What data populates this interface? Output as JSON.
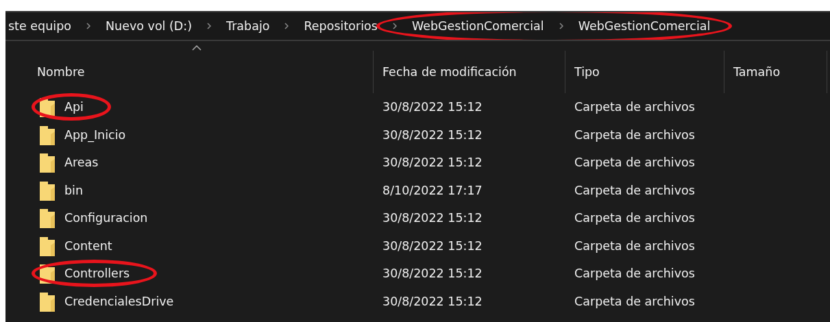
{
  "breadcrumb": [
    {
      "label": "ste equipo",
      "highlighted": false
    },
    {
      "label": "Nuevo vol (D:)",
      "highlighted": false
    },
    {
      "label": "Trabajo",
      "highlighted": false
    },
    {
      "label": "Repositorios",
      "highlighted": false
    },
    {
      "label": "WebGestionComercial",
      "highlighted": true
    },
    {
      "label": "WebGestionComercial",
      "highlighted": true
    }
  ],
  "columns": [
    {
      "label": "Nombre",
      "sorted": true
    },
    {
      "label": "Fecha de modificación",
      "sorted": false
    },
    {
      "label": "Tipo",
      "sorted": false
    },
    {
      "label": "Tamaño",
      "sorted": false
    }
  ],
  "rows": [
    {
      "name": "Api",
      "modified": "30/8/2022 15:12",
      "type": "Carpeta de archivos",
      "highlighted": true
    },
    {
      "name": "App_Inicio",
      "modified": "30/8/2022 15:12",
      "type": "Carpeta de archivos",
      "highlighted": false
    },
    {
      "name": "Areas",
      "modified": "30/8/2022 15:12",
      "type": "Carpeta de archivos",
      "highlighted": false
    },
    {
      "name": "bin",
      "modified": "8/10/2022 17:17",
      "type": "Carpeta de archivos",
      "highlighted": false
    },
    {
      "name": "Configuracion",
      "modified": "30/8/2022 15:12",
      "type": "Carpeta de archivos",
      "highlighted": false
    },
    {
      "name": "Content",
      "modified": "30/8/2022 15:12",
      "type": "Carpeta de archivos",
      "highlighted": false
    },
    {
      "name": "Controllers",
      "modified": "30/8/2022 15:12",
      "type": "Carpeta de archivos",
      "highlighted": true
    },
    {
      "name": "CredencialesDrive",
      "modified": "30/8/2022 15:12",
      "type": "Carpeta de archivos",
      "highlighted": false
    }
  ]
}
